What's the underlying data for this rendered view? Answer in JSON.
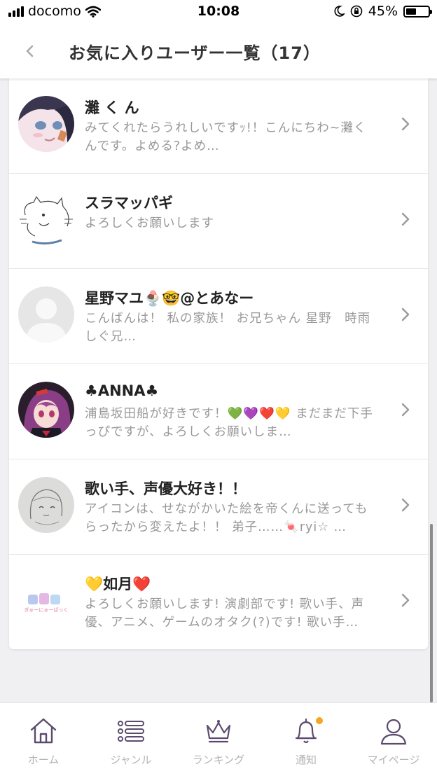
{
  "status_bar": {
    "carrier": "docomo",
    "time": "10:08",
    "battery": "45%",
    "battery_level": 0.45
  },
  "header": {
    "title": "お気に入りユーザー一覧（17）"
  },
  "users": [
    {
      "name": "灘 く ん",
      "bio": "みてくれたらうれしいですｯ!！こんにちわ~灘くんです。よめる?よめ…",
      "avatar": "avatar-anime-girl-blue-hair"
    },
    {
      "name": "スラマッパギ",
      "bio": "よろしくお願いします",
      "avatar": "avatar-cat-sketch"
    },
    {
      "name": "星野マユ🍨🤓@とあなー",
      "bio": "こんばんは！ 私の家族！ お兄ちゃん 星野　時雨　しぐ兄…",
      "avatar": "avatar-default-person"
    },
    {
      "name": "♣ANNA♣",
      "bio": "浦島坂田船が好きです！💚💜❤️💛 まだまだ下手っぴですが、よろしくお願いしま…",
      "avatar": "avatar-anime-girl-purple-hair"
    },
    {
      "name": "歌い手、声優大好き！！",
      "bio": "アイコンは、せながかいた絵を帝くんに送ってもらったから変えたよ！！ 弟子……🍬ryi☆ …",
      "avatar": "avatar-pencil-drawing"
    },
    {
      "name": "💛如月❤️",
      "bio": "よろしくお願いします! 演劇部です! 歌い手、声優、アニメ、ゲームのオタク(?)です! 歌い手…",
      "avatar": "avatar-pastel-logo",
      "avatar_text": "ぎゅーにゅーぱっく"
    }
  ],
  "tabs": [
    {
      "label": "ホーム",
      "icon": "home-icon"
    },
    {
      "label": "ジャンル",
      "icon": "list-icon"
    },
    {
      "label": "ランキング",
      "icon": "crown-icon"
    },
    {
      "label": "通知",
      "icon": "bell-icon",
      "badge": true
    },
    {
      "label": "マイページ",
      "icon": "person-icon"
    }
  ],
  "colors": {
    "icon_purple": "#5c4a6e",
    "badge_orange": "#f5a623",
    "tab_label": "#b3b3b3",
    "bio_gray": "#999999"
  }
}
